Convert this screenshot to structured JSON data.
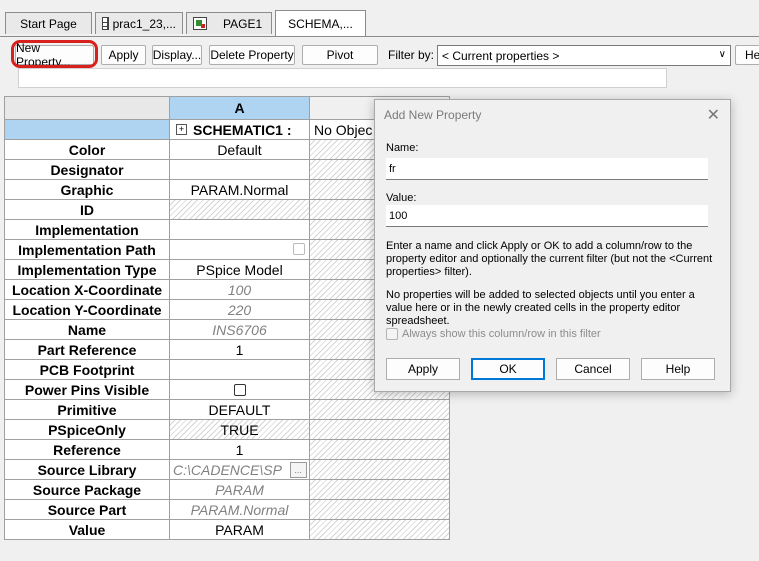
{
  "tabs": [
    {
      "label": "Start Page",
      "icon": "none"
    },
    {
      "label": "prac1_23,...",
      "icon": "grid-icon"
    },
    {
      "label": "PAGE1",
      "icon": "schematic-page-icon"
    },
    {
      "label": "SCHEMA,...",
      "icon": "none",
      "active": true
    }
  ],
  "toolbar": {
    "new_property": "New Property...",
    "apply": "Apply",
    "display": "Display...",
    "delete_property": "Delete Property",
    "pivot": "Pivot",
    "filter_label": "Filter by:",
    "filter_value": "< Current properties >",
    "help": "He"
  },
  "sheet": {
    "column_a": "A",
    "object_name": "SCHEMATIC1 :",
    "next_header": "No Objec",
    "rows": [
      {
        "name": "Color",
        "value": "Default",
        "style": "normal"
      },
      {
        "name": "Designator",
        "value": "",
        "style": "normal"
      },
      {
        "name": "Graphic",
        "value": "PARAM.Normal",
        "style": "normal"
      },
      {
        "name": "ID",
        "value": "",
        "style": "hatch"
      },
      {
        "name": "Implementation",
        "value": "",
        "style": "normal"
      },
      {
        "name": "Implementation Path",
        "value": "",
        "style": "normal"
      },
      {
        "name": "Implementation Type",
        "value": "PSpice Model",
        "style": "normal"
      },
      {
        "name": "Location X-Coordinate",
        "value": "100",
        "style": "italic"
      },
      {
        "name": "Location Y-Coordinate",
        "value": "220",
        "style": "italic"
      },
      {
        "name": "Name",
        "value": "INS6706",
        "style": "italic"
      },
      {
        "name": "Part Reference",
        "value": "1",
        "style": "normal"
      },
      {
        "name": "PCB Footprint",
        "value": "",
        "style": "normal"
      },
      {
        "name": "Power Pins Visible",
        "value": "",
        "style": "checkbox"
      },
      {
        "name": "Primitive",
        "value": "DEFAULT",
        "style": "normal"
      },
      {
        "name": "PSpiceOnly",
        "value": "TRUE",
        "style": "hatch"
      },
      {
        "name": "Reference",
        "value": "1",
        "style": "normal"
      },
      {
        "name": "Source Library",
        "value": "C:\\CADENCE\\SP",
        "style": "italic"
      },
      {
        "name": "Source Package",
        "value": "PARAM",
        "style": "italic"
      },
      {
        "name": "Source Part",
        "value": "PARAM.Normal",
        "style": "italic"
      },
      {
        "name": "Value",
        "value": "PARAM",
        "style": "normal"
      }
    ]
  },
  "dialog": {
    "title": "Add New Property",
    "name_label": "Name:",
    "name_value": "fr",
    "value_label": "Value:",
    "value_value": "100",
    "info1": "Enter a name and click Apply or OK to add a column/row to the property editor and optionally the current filter (but not the <Current properties> filter).",
    "info2": "No properties will be added to selected objects until you enter a value here or in the newly created cells in the property editor spreadsheet.",
    "always_show": "Always show this column/row in this filter",
    "buttons": {
      "apply": "Apply",
      "ok": "OK",
      "cancel": "Cancel",
      "help": "Help"
    }
  },
  "colors": {
    "column_header": "#aed4f2",
    "annotation": "#d8201c",
    "default_button": "#0078d7"
  }
}
